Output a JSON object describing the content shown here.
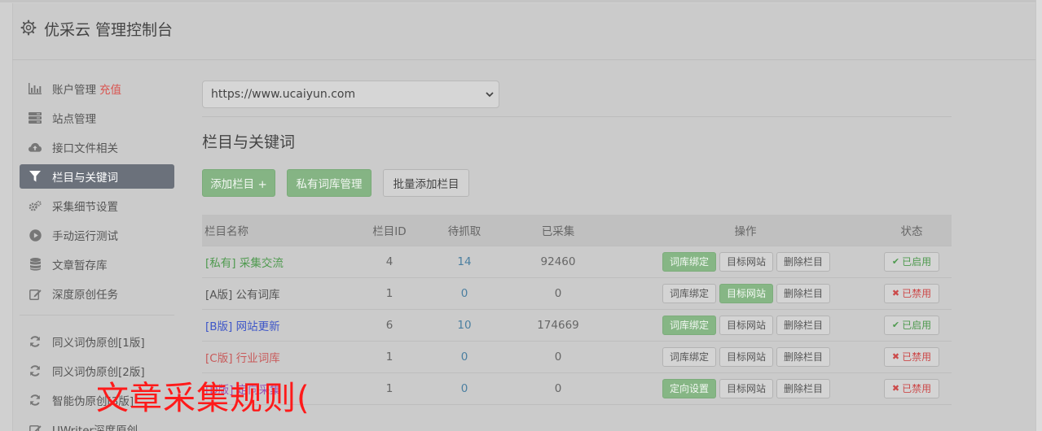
{
  "header": {
    "title": "优采云 管理控制台",
    "icon": "gear-icon"
  },
  "sidebar": {
    "items": [
      {
        "label": "账户管理",
        "extra": "充值",
        "icon": "bar-chart-icon"
      },
      {
        "label": "站点管理",
        "icon": "server-icon"
      },
      {
        "label": "接口文件相关",
        "icon": "cloud-upload-icon"
      },
      {
        "label": "栏目与关键词",
        "icon": "filter-icon",
        "active": true
      },
      {
        "label": "采集细节设置",
        "icon": "gears-icon"
      },
      {
        "label": "手动运行测试",
        "icon": "play-circle-icon"
      },
      {
        "label": "文章暂存库",
        "icon": "database-icon"
      },
      {
        "label": "深度原创任务",
        "icon": "edit-icon"
      }
    ],
    "items2": [
      {
        "label": "同义词伪原创[1版]",
        "icon": "refresh-icon"
      },
      {
        "label": "同义词伪原创[2版]",
        "icon": "refresh-icon"
      },
      {
        "label": "智能伪原创[3版]",
        "icon": "refresh-icon"
      },
      {
        "label": "UWriter深度原创",
        "icon": "edit-icon"
      }
    ]
  },
  "site_select": {
    "value": "https://www.ucaiyun.com"
  },
  "section": {
    "title": "栏目与关键词"
  },
  "toolbar": {
    "add_column": "添加栏目 +",
    "private_lexicon": "私有词库管理",
    "batch_add": "批量添加栏目"
  },
  "table": {
    "headers": [
      "栏目名称",
      "栏目ID",
      "待抓取",
      "已采集",
      "操作",
      "状态"
    ],
    "rows": [
      {
        "name": "[私有] 采集交流",
        "name_color": "#4f9a4f",
        "id": "4",
        "pending": "14",
        "collected": "92460",
        "op1": "词库绑定",
        "op1_style": "green",
        "op2": "目标网站",
        "op2_style": "default",
        "op3": "删除栏目",
        "status": "已启用",
        "status_on": true
      },
      {
        "name": "[A版] 公有词库",
        "name_color": "#555555",
        "id": "1",
        "pending": "0",
        "collected": "0",
        "op1": "词库绑定",
        "op1_style": "default",
        "op2": "目标网站",
        "op2_style": "green",
        "op3": "删除栏目",
        "status": "已禁用",
        "status_on": false
      },
      {
        "name": "[B版] 网站更新",
        "name_color": "#3f57c8",
        "id": "6",
        "pending": "10",
        "collected": "174669",
        "op1": "词库绑定",
        "op1_style": "green",
        "op2": "目标网站",
        "op2_style": "default",
        "op3": "删除栏目",
        "status": "已启用",
        "status_on": true
      },
      {
        "name": "[C版] 行业词库",
        "name_color": "#c85a5a",
        "id": "1",
        "pending": "0",
        "collected": "0",
        "op1": "词库绑定",
        "op1_style": "default",
        "op2": "目标网站",
        "op2_style": "default",
        "op3": "删除栏目",
        "status": "已禁用",
        "status_on": false
      },
      {
        "name": "[D版] 定向采集",
        "name_color": "#9a54b8",
        "id": "1",
        "pending": "0",
        "collected": "0",
        "op1": "定向设置",
        "op1_style": "green",
        "op2": "目标网站",
        "op2_style": "default",
        "op3": "删除栏目",
        "status": "已禁用",
        "status_on": false
      }
    ]
  },
  "overlay_text": "文章采集规则(",
  "colors": {
    "active_nav": "#6b717b",
    "green_button": "#85b484",
    "recharge": "#d9534f",
    "overlay": "#ff1a1a"
  }
}
